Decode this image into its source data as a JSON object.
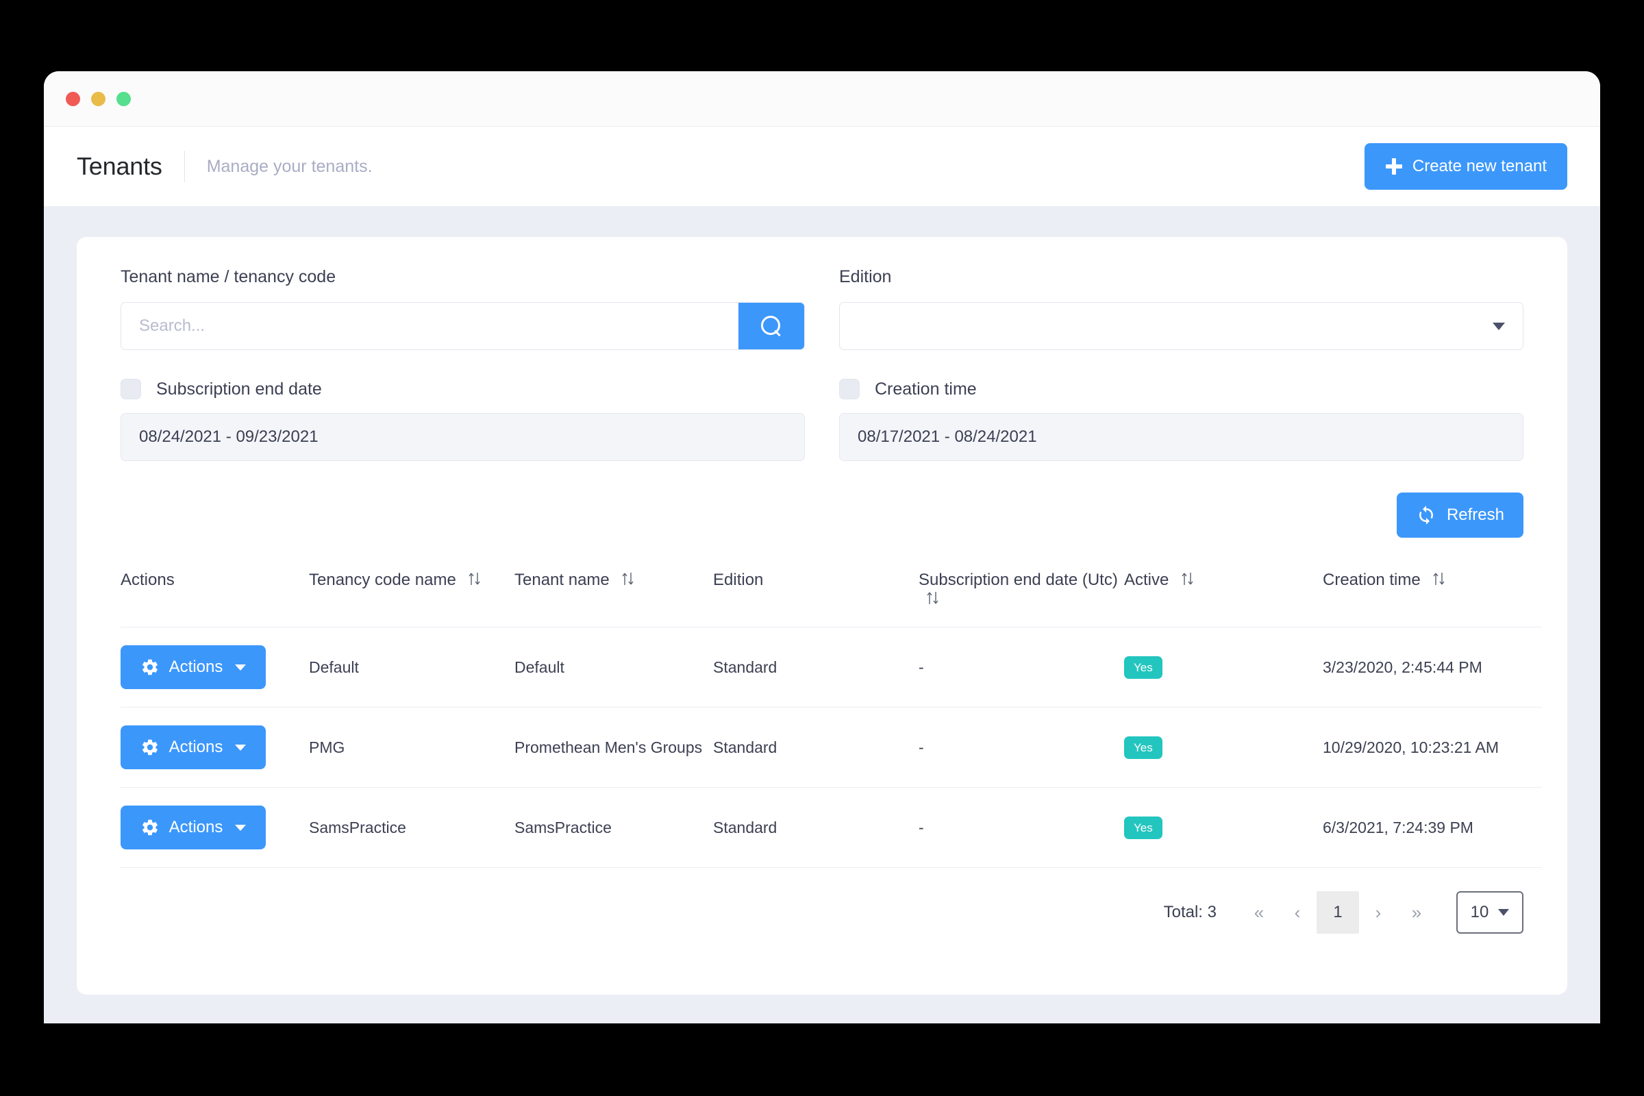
{
  "window": {
    "traffic_lights": [
      "close",
      "minimize",
      "maximize"
    ]
  },
  "header": {
    "title": "Tenants",
    "subtitle": "Manage your tenants.",
    "create_button": "Create new tenant",
    "create_icon": "plus-icon"
  },
  "filters": {
    "search_label": "Tenant name / tenancy code",
    "search_placeholder": "Search...",
    "search_value": "",
    "search_icon": "search-icon",
    "edition_label": "Edition",
    "edition_value": "",
    "subscription_checkbox_label": "Subscription end date",
    "subscription_checked": false,
    "subscription_range": "08/24/2021 - 09/23/2021",
    "creation_checkbox_label": "Creation time",
    "creation_checked": false,
    "creation_range": "08/17/2021 - 08/24/2021",
    "refresh_button": "Refresh",
    "refresh_icon": "refresh-icon"
  },
  "table": {
    "columns": [
      {
        "label": "Actions",
        "sortable": false
      },
      {
        "label": "Tenancy code name",
        "sortable": true
      },
      {
        "label": "Tenant name",
        "sortable": true
      },
      {
        "label": "Edition",
        "sortable": false
      },
      {
        "label": "Subscription end date (Utc)",
        "sortable": true
      },
      {
        "label": "Active",
        "sortable": true
      },
      {
        "label": "Creation time",
        "sortable": true
      }
    ],
    "action_label": "Actions",
    "action_icon": "gear-icon",
    "rows": [
      {
        "tenancy_code": "Default",
        "tenant_name": "Default",
        "edition": "Standard",
        "subscription_end_date": "-",
        "active": "Yes",
        "creation_time": "3/23/2020, 2:45:44 PM"
      },
      {
        "tenancy_code": "PMG",
        "tenant_name": "Promethean Men's Groups",
        "edition": "Standard",
        "subscription_end_date": "-",
        "active": "Yes",
        "creation_time": "10/29/2020, 10:23:21 AM"
      },
      {
        "tenancy_code": "SamsPractice",
        "tenant_name": "SamsPractice",
        "edition": "Standard",
        "subscription_end_date": "-",
        "active": "Yes",
        "creation_time": "6/3/2021, 7:24:39 PM"
      }
    ]
  },
  "pagination": {
    "total": "Total: 3",
    "first": "«",
    "prev": "‹",
    "current_page": "1",
    "next": "›",
    "last": "»",
    "page_size": "10"
  },
  "colors": {
    "accent_blue": "#3c97fb",
    "badge_teal": "#23c5bf",
    "page_bg": "#eceef5"
  }
}
